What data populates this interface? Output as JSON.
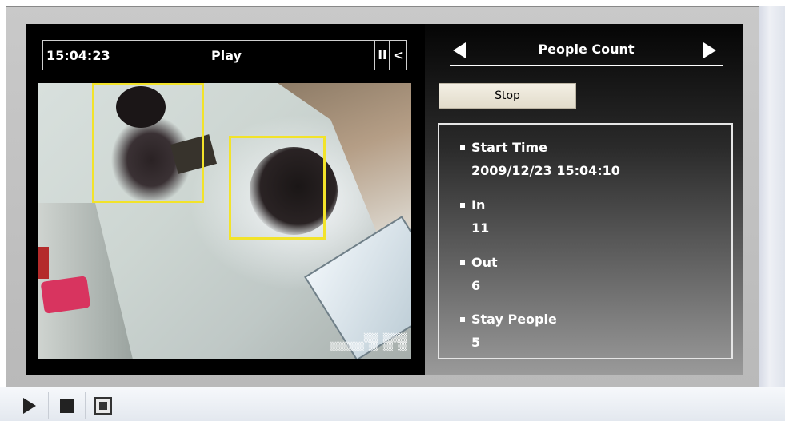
{
  "player": {
    "time": "15:04:23",
    "state": "Play",
    "pause_glyph": "II",
    "prev_glyph": "<"
  },
  "panel": {
    "title": "People Count",
    "prev_icon": "triangle-left-icon",
    "next_icon": "triangle-right-icon",
    "stop_label": "Stop"
  },
  "stats": [
    {
      "label": "Start Time",
      "value": "2009/12/23 15:04:10"
    },
    {
      "label": "In",
      "value": "11"
    },
    {
      "label": "Out",
      "value": "6"
    },
    {
      "label": "Stay People",
      "value": "5"
    }
  ],
  "video": {
    "detections": 2,
    "box_color": "#f2e32a"
  },
  "toolbar": {
    "icons": [
      "play-icon",
      "stop-icon",
      "fullscreen-icon"
    ]
  },
  "colors": {
    "panel_bg": "#000000",
    "frame": "#c4c4c4",
    "stop_button": "#ece6d6"
  }
}
